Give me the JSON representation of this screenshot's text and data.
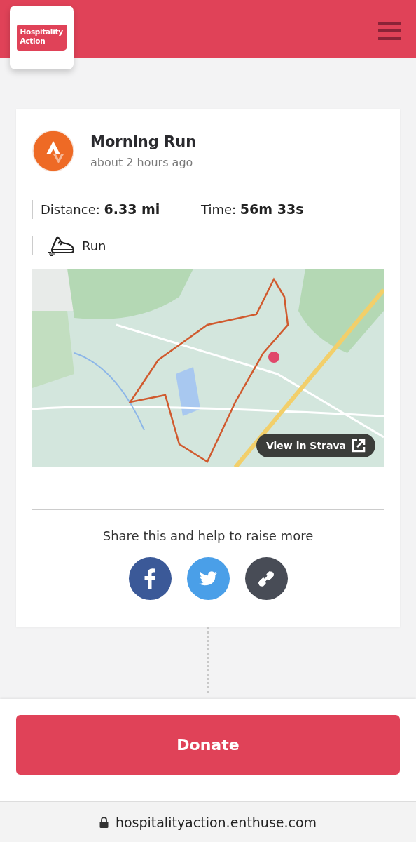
{
  "header": {
    "logo_text": "Hospitality Action"
  },
  "activity": {
    "title": "Morning Run",
    "time_ago": "about 2 hours ago",
    "stats": [
      {
        "label": "Distance:",
        "value": "6.33 mi"
      },
      {
        "label": "Time:",
        "value": "56m 33s"
      }
    ],
    "type": "Run",
    "map": {
      "button": "View in Strava"
    }
  },
  "share": {
    "text": "Share this and help to raise more",
    "buttons": [
      {
        "kind": "facebook",
        "color": "#3b5998"
      },
      {
        "kind": "twitter",
        "color": "#4a9fe8"
      },
      {
        "kind": "link",
        "color": "#484c56"
      }
    ]
  },
  "donate_button": "Donate",
  "browser": {
    "url": "hospitalityaction.enthuse.com"
  }
}
